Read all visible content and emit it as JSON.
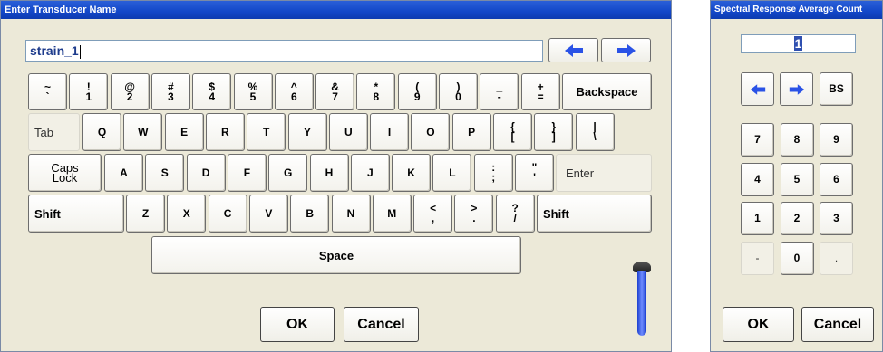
{
  "keyboard_dialog": {
    "title": "Enter Transducer Name",
    "input_value": "strain_1",
    "rows": [
      [
        [
          "~",
          "`"
        ],
        [
          "!",
          "1"
        ],
        [
          "@",
          "2"
        ],
        [
          "#",
          "3"
        ],
        [
          "$",
          "4"
        ],
        [
          "%",
          "5"
        ],
        [
          "^",
          "6"
        ],
        [
          "&",
          "7"
        ],
        [
          "*",
          "8"
        ],
        [
          "(",
          "9"
        ],
        [
          ")",
          "0"
        ],
        [
          "_",
          "-"
        ],
        [
          "+",
          "="
        ]
      ],
      [
        [
          "",
          "Q"
        ],
        [
          "",
          "W"
        ],
        [
          "",
          "E"
        ],
        [
          "",
          "R"
        ],
        [
          "",
          "T"
        ],
        [
          "",
          "Y"
        ],
        [
          "",
          "U"
        ],
        [
          "",
          "I"
        ],
        [
          "",
          "O"
        ],
        [
          "",
          "P"
        ],
        [
          "{",
          "["
        ],
        [
          "}",
          "]"
        ],
        [
          "|",
          "\\"
        ]
      ],
      [
        [
          "",
          "A"
        ],
        [
          "",
          "S"
        ],
        [
          "",
          "D"
        ],
        [
          "",
          "F"
        ],
        [
          "",
          "G"
        ],
        [
          "",
          "H"
        ],
        [
          "",
          "J"
        ],
        [
          "",
          "K"
        ],
        [
          "",
          "L"
        ],
        [
          ":",
          ";"
        ],
        [
          "\"",
          "'"
        ]
      ],
      [
        [
          "",
          "Z"
        ],
        [
          "",
          "X"
        ],
        [
          "",
          "C"
        ],
        [
          "",
          "V"
        ],
        [
          "",
          "B"
        ],
        [
          "",
          "N"
        ],
        [
          "",
          "M"
        ],
        [
          "<",
          ","
        ],
        [
          ">",
          "."
        ],
        [
          "?",
          "/"
        ]
      ]
    ],
    "backspace_label": "Backspace",
    "tab_label": "Tab",
    "caps_label_1": "Caps",
    "caps_label_2": "Lock",
    "enter_label": "Enter",
    "shift_label": "Shift",
    "space_label": "Space",
    "ok_label": "OK",
    "cancel_label": "Cancel",
    "arrow_color": "#2a52e6"
  },
  "numpad_dialog": {
    "title": "Spectral Response Average Count",
    "input_value": "1",
    "bs_label": "BS",
    "keys": [
      "7",
      "8",
      "9",
      "4",
      "5",
      "6",
      "1",
      "2",
      "3",
      "-",
      "0",
      "."
    ],
    "ok_label": "OK",
    "cancel_label": "Cancel"
  }
}
